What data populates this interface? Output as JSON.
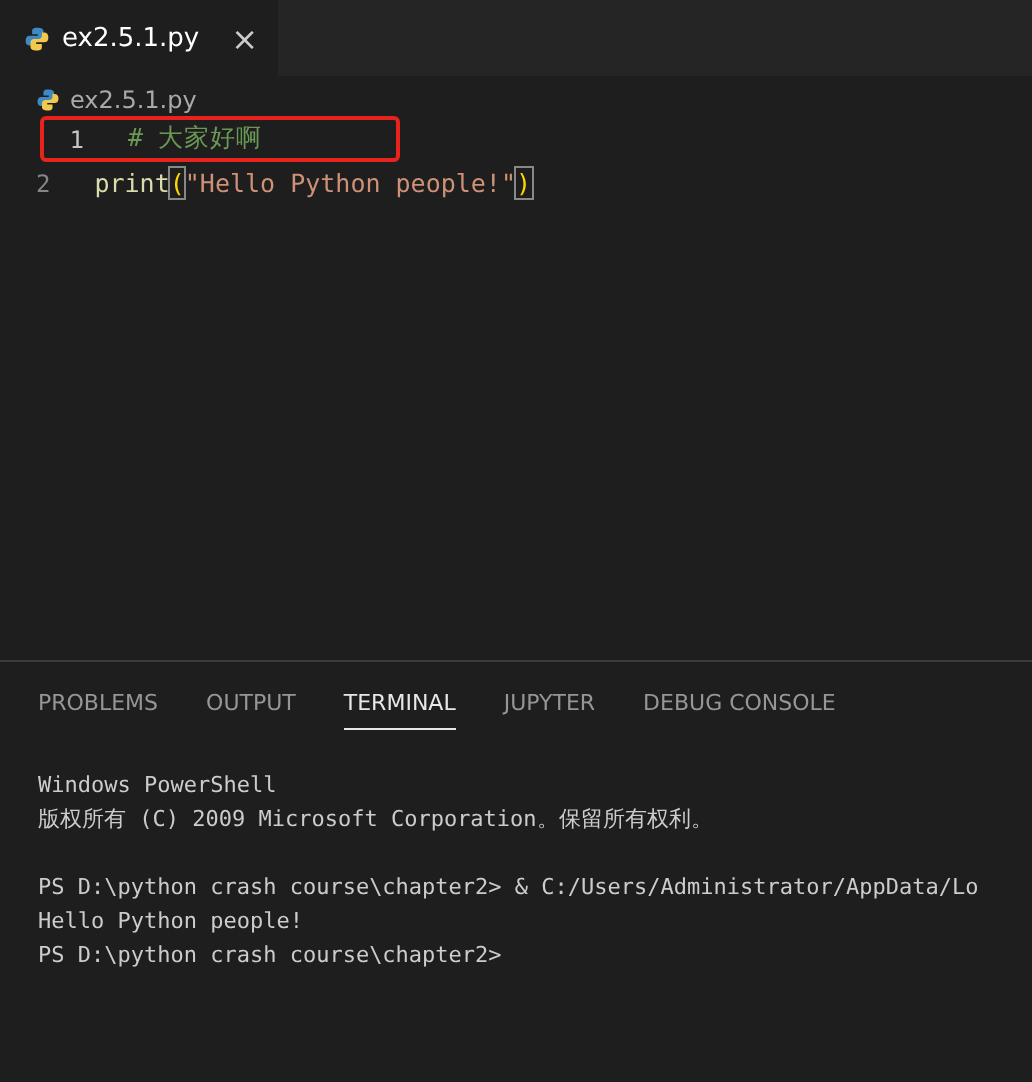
{
  "editor_tabs": [
    {
      "label": "ex2.5.1.py",
      "close": "×",
      "selected": true
    }
  ],
  "breadcrumb": "ex2.5.1.py",
  "code_lines": [
    {
      "number": "1",
      "annotated": true,
      "tokens": [
        {
          "kind": "comment",
          "text": "# 大家好啊"
        }
      ]
    },
    {
      "number": "2",
      "annotated": false,
      "tokens": [
        {
          "kind": "func",
          "text": "print"
        },
        {
          "kind": "bracket",
          "text": "("
        },
        {
          "kind": "string",
          "text": "\"Hello Python people!\""
        },
        {
          "kind": "bracket",
          "text": ")"
        }
      ]
    }
  ],
  "panel_tabs": [
    {
      "label": "PROBLEMS",
      "selected": false
    },
    {
      "label": "OUTPUT",
      "selected": false
    },
    {
      "label": "TERMINAL",
      "selected": true
    },
    {
      "label": "JUPYTER",
      "selected": false
    },
    {
      "label": "DEBUG CONSOLE",
      "selected": false
    }
  ],
  "terminal_blocks": [
    {
      "lines": [
        "Windows PowerShell",
        "版权所有 (C) 2009 Microsoft Corporation。保留所有权利。"
      ]
    },
    {
      "lines": [
        "PS D:\\python crash course\\chapter2> & C:/Users/Administrator/AppData/Lo",
        "Hello Python people!",
        "PS D:\\python crash course\\chapter2>"
      ]
    }
  ]
}
